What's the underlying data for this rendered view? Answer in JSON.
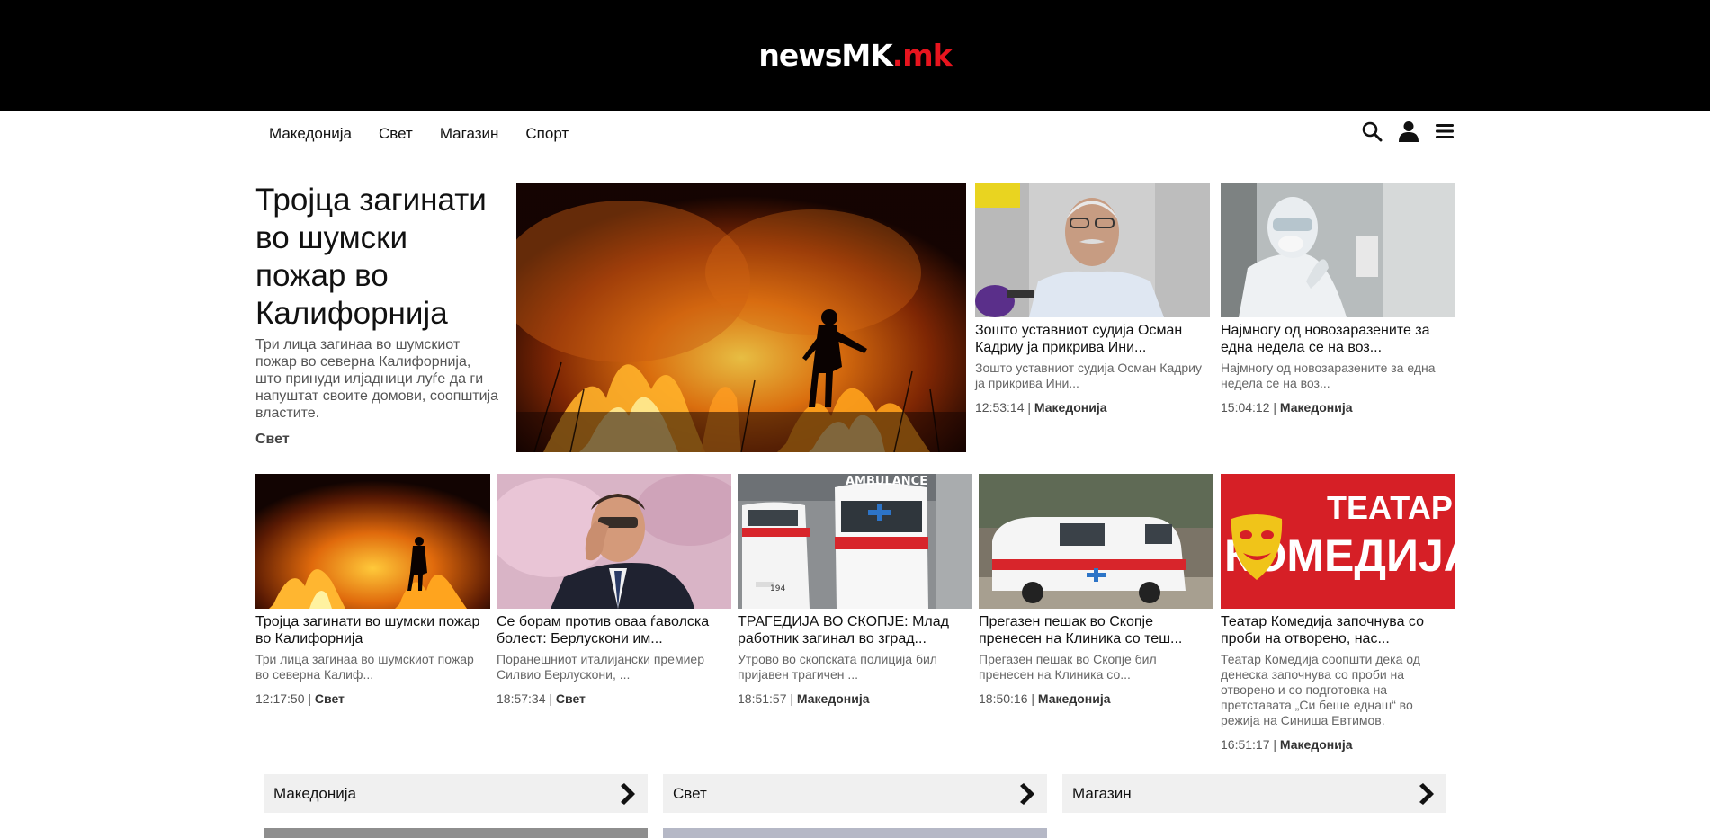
{
  "header": {
    "logo_main": "newsMK",
    "logo_suffix": ".mk"
  },
  "nav": {
    "items": [
      {
        "label": "Македонија"
      },
      {
        "label": "Свет"
      },
      {
        "label": "Магазин"
      },
      {
        "label": "Спорт"
      }
    ],
    "icons": [
      "search-icon",
      "user-icon",
      "menu-icon"
    ]
  },
  "hero": {
    "title": "Тројца загинати во шумски пожар во Калифорнија",
    "description": "Три лица загинаа во шумскиот пожар во северна Калифорнија, што принуди илјадници луѓе да ги напуштат своите домови, соопштија властите.",
    "category": "Свет"
  },
  "top_cards": [
    {
      "title": "Зошто уставниот судија Осман Кадриу ја прикрива Ини...",
      "desc": "Зошто уставниот судија Осман Кадриу ја прикрива Ини...",
      "time": "12:53:14",
      "category": "Македонија"
    },
    {
      "title": "Најмногу од новозаразените за една недела се на воз...",
      "desc": "Најмногу од новозаразените за една недела се на воз...",
      "time": "15:04:12",
      "category": "Македонија"
    }
  ],
  "row_cards": [
    {
      "title": "Тројца загинати во шумски пожар во Калифорнија",
      "desc": "Три лица загинаа во шумскиот пожар во северна Калиф...",
      "time": "12:17:50",
      "category": "Свет"
    },
    {
      "title": "Се борам против оваа ѓаволска болест: Берлускони им...",
      "desc": "Поранешниот италијански премиер Силвио Берлускони, ...",
      "time": "18:57:34",
      "category": "Свет"
    },
    {
      "title": "ТРАГЕДИЈА ВО СКОПЈЕ: Млад работник загинал во зград...",
      "desc": "Утрово во скопската полиција бил пријавен трагичен ...",
      "time": "18:51:57",
      "category": "Македонија"
    },
    {
      "title": "Прегазен пешак во Скопје пренесен на Клиника со теш...",
      "desc": "Прегазен пешак во Скопје бил пренесен на Клиника со...",
      "time": "18:50:16",
      "category": "Македонија"
    },
    {
      "title": "Театар Комедија започнува со проби на отворено, нас...",
      "desc": "Театар Комедија соопшти дека од денеска започнува со проби на отворено и со подготовка на претставата „Си беше еднаш“ во режија на Синиша Евтимов.",
      "time": "16:51:17",
      "category": "Македонија"
    }
  ],
  "theater_image": {
    "line1": "ТЕАТАР",
    "line2": "КОМЕДИЈА"
  },
  "ambulance_text": "AMBULANCE",
  "ambulance_plate": "194",
  "sections": [
    {
      "label": "Македонија"
    },
    {
      "label": "Свет"
    },
    {
      "label": "Магазин"
    }
  ],
  "colors": {
    "brand_red": "#e8141e",
    "header_bg": "#000000",
    "section_bar": "#f0f0f0"
  },
  "separator": "|"
}
